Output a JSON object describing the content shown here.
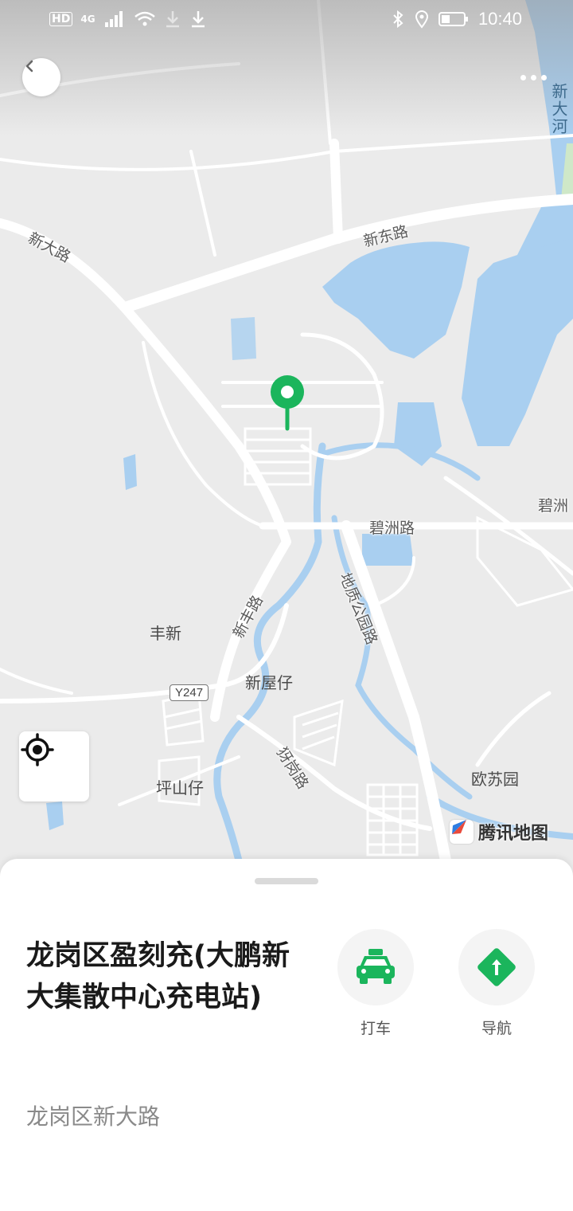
{
  "status_bar": {
    "indicators": [
      "HD",
      "4G"
    ],
    "time": "10:40",
    "icons": [
      "signal-icon",
      "wifi-icon",
      "download-icon",
      "download-icon",
      "bluetooth-icon",
      "location-icon",
      "battery-icon"
    ]
  },
  "map": {
    "labels": {
      "river": "新大河",
      "xinda_road": "新大路",
      "xindong_road": "新东路",
      "bizhou_road": "碧洲路",
      "bizhou_right": "碧洲",
      "dizhi_park_road": "地质公园路",
      "xinfeng_road": "新丰路",
      "fengxin": "丰新",
      "xinwuzai": "新屋仔",
      "road_badge": "Y247",
      "yagang_road": "犽岗路",
      "pingshanzai": "坪山仔",
      "ousu_garden": "欧苏园"
    },
    "brand": "腾讯地图",
    "colors": {
      "background": "#ebebeb",
      "road": "#ffffff",
      "water": "#a9cff0",
      "pin": "#1bb55c",
      "park": "#cfe8c8"
    }
  },
  "place": {
    "title": "龙岗区盈刻充(大鹏新大集散中心充电站)",
    "address": "龙岗区新大路"
  },
  "actions": {
    "taxi_label": "打车",
    "nav_label": "导航",
    "accent": "#1bb55c"
  }
}
